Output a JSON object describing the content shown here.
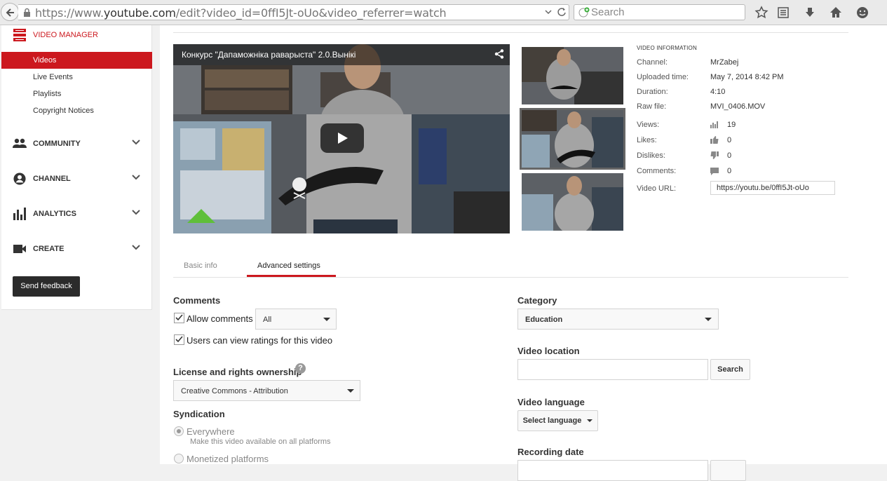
{
  "browser": {
    "url_prefix": "https://www.",
    "url_domain": "youtube.com",
    "url_rest": "/edit?video_id=0ffI5Jt-oUo&video_referrer=watch",
    "search_placeholder": "Search"
  },
  "sidebar": {
    "title": "VIDEO MANAGER",
    "sub_items": [
      {
        "label": "Videos",
        "active": true
      },
      {
        "label": "Live Events",
        "active": false
      },
      {
        "label": "Playlists",
        "active": false
      },
      {
        "label": "Copyright Notices",
        "active": false
      }
    ],
    "sections": [
      {
        "label": "COMMUNITY",
        "icon": "people-icon"
      },
      {
        "label": "CHANNEL",
        "icon": "account-icon"
      },
      {
        "label": "ANALYTICS",
        "icon": "bar-chart-icon"
      },
      {
        "label": "CREATE",
        "icon": "video-camera-icon"
      }
    ],
    "feedback_button": "Send feedback"
  },
  "player": {
    "title": "Конкурс \"Дапаможніка раварыста\" 2.0.Вынікі"
  },
  "video_info": {
    "heading": "VIDEO INFORMATION",
    "channel_label": "Channel:",
    "channel": "MrZabej",
    "uploaded_label": "Uploaded time:",
    "uploaded": "May 7, 2014 8:42 PM",
    "duration_label": "Duration:",
    "duration": "4:10",
    "raw_file_label": "Raw file:",
    "raw_file": "MVI_0406.MOV",
    "views_label": "Views:",
    "views": "19",
    "likes_label": "Likes:",
    "likes": "0",
    "dislikes_label": "Dislikes:",
    "dislikes": "0",
    "comments_label": "Comments:",
    "comments": "0",
    "url_label": "Video URL:",
    "url": "https://youtu.be/0ffI5Jt-oUo"
  },
  "tabs": {
    "basic": "Basic info",
    "advanced": "Advanced settings"
  },
  "form": {
    "comments_heading": "Comments",
    "allow_comments": "Allow comments",
    "allow_comments_select": "All",
    "view_ratings": "Users can view ratings for this video",
    "license_heading": "License and rights ownership",
    "license_value": "Creative Commons - Attribution",
    "syndication_heading": "Syndication",
    "everywhere": "Everywhere",
    "everywhere_sub": "Make this video available on all platforms",
    "monetized": "Monetized platforms",
    "category_heading": "Category",
    "category_value": "Education",
    "location_heading": "Video location",
    "location_search": "Search",
    "language_heading": "Video language",
    "language_select": "Select language",
    "recording_heading": "Recording date"
  },
  "colors": {
    "accent": "#cc181e"
  }
}
